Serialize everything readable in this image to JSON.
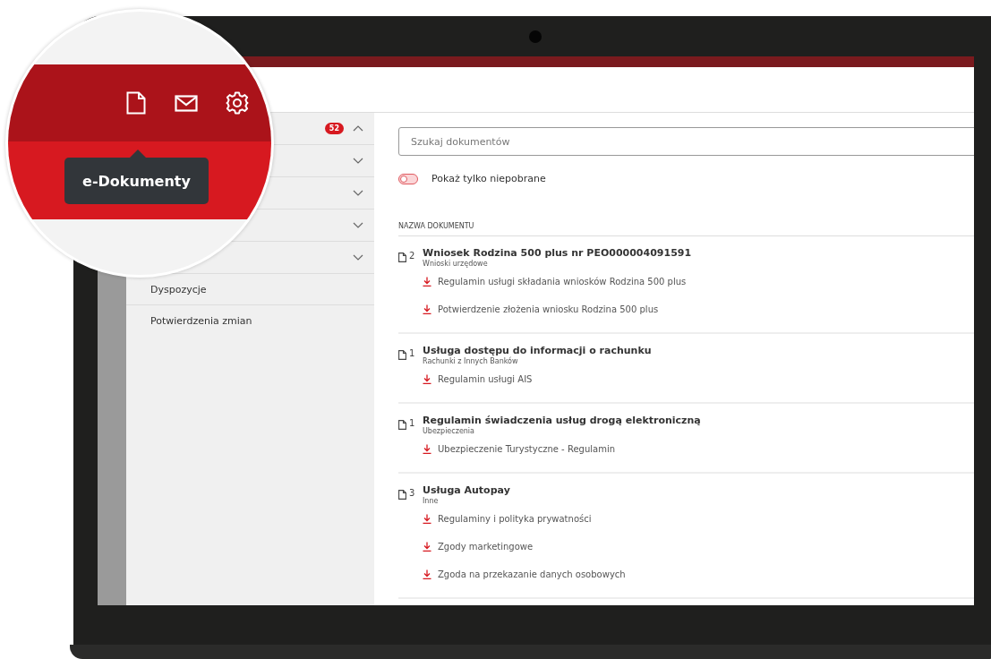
{
  "header": {
    "tooltip": "e-Dokumenty"
  },
  "sidebar": {
    "sections": [
      {
        "badge": "52",
        "expanded": true
      },
      {
        "expanded": false
      },
      {
        "expanded": false
      },
      {
        "expanded": false
      },
      {
        "expanded": false
      }
    ],
    "items": [
      "Dyspozycje",
      "Potwierdzenia zmian"
    ]
  },
  "search": {
    "placeholder": "Szukaj dokumentów"
  },
  "filter": {
    "label": "Pokaż tylko niepobrane",
    "on": false
  },
  "table": {
    "column": "NAZWA DOKUMENTU",
    "documents": [
      {
        "count": "2",
        "title": "Wniosek Rodzina 500 plus nr PEO000004091591",
        "category": "Wnioski urzędowe",
        "files": [
          "Regulamin usługi składania wniosków Rodzina 500 plus",
          "Potwierdzenie złożenia wniosku Rodzina 500 plus"
        ]
      },
      {
        "count": "1",
        "title": "Usługa dostępu do informacji o rachunku",
        "category": "Rachunki z Innych Banków",
        "files": [
          "Regulamin usługi AIS"
        ]
      },
      {
        "count": "1",
        "title": "Regulamin świadczenia usług drogą elektroniczną",
        "category": "Ubezpieczenia",
        "files": [
          "Ubezpieczenie Turystyczne - Regulamin"
        ]
      },
      {
        "count": "3",
        "title": "Usługa Autopay",
        "category": "Inne",
        "files": [
          "Regulaminy i polityka prywatności",
          "Zgody marketingowe",
          "Zgoda na przekazanie danych osobowych"
        ]
      }
    ]
  }
}
